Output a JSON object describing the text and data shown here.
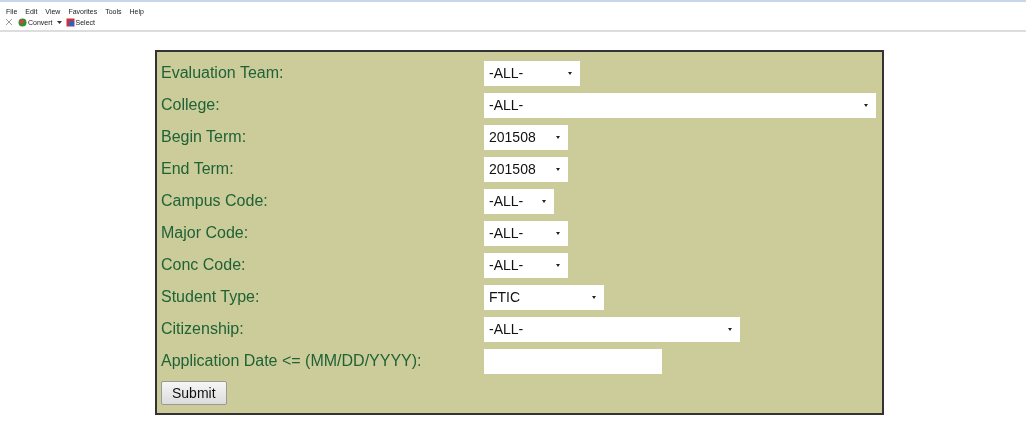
{
  "menu_bar": [
    "File",
    "Edit",
    "View",
    "Favorites",
    "Tools",
    "Help"
  ],
  "toolbar": {
    "convert": "Convert",
    "select": "Select"
  },
  "form": {
    "fields": [
      {
        "label": "Evaluation Team:",
        "kind": "select",
        "value": "-ALL-"
      },
      {
        "label": "College:",
        "kind": "select",
        "value": "-ALL-"
      },
      {
        "label": "Begin Term:",
        "kind": "select",
        "value": "201508"
      },
      {
        "label": "End Term:",
        "kind": "select",
        "value": "201508"
      },
      {
        "label": "Campus Code:",
        "kind": "select",
        "value": "-ALL-"
      },
      {
        "label": "Major Code:",
        "kind": "select",
        "value": "-ALL-"
      },
      {
        "label": "Conc Code:",
        "kind": "select",
        "value": "-ALL-"
      },
      {
        "label": "Student Type:",
        "kind": "select",
        "value": "FTIC"
      },
      {
        "label": "Citizenship:",
        "kind": "select",
        "value": "-ALL-"
      },
      {
        "label": "Application Date <= (MM/DD/YYYY):",
        "kind": "text"
      }
    ],
    "submit": "Submit"
  }
}
